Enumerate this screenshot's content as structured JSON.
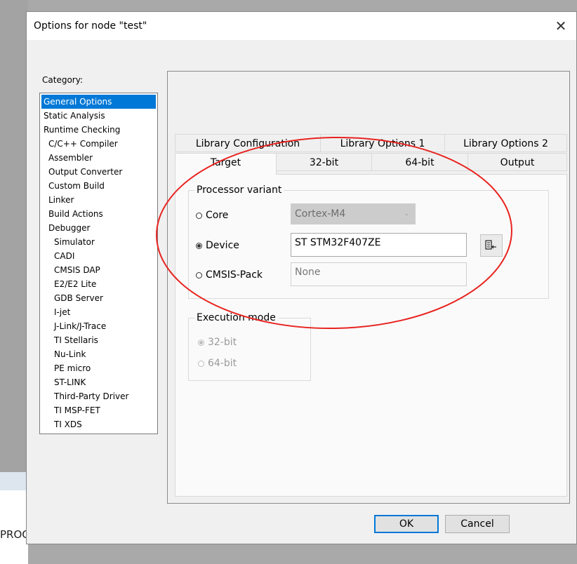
{
  "background": {
    "truncated_text": "PROC"
  },
  "dialog": {
    "title": "Options for node \"test\"",
    "close_glyph": "✕"
  },
  "category": {
    "label": "Category:",
    "items": [
      {
        "label": "General Options",
        "selected": true
      },
      {
        "label": "Static Analysis"
      },
      {
        "label": "Runtime Checking"
      },
      {
        "label": "C/C++ Compiler"
      },
      {
        "label": "Assembler"
      },
      {
        "label": "Output Converter"
      },
      {
        "label": "Custom Build"
      },
      {
        "label": "Linker"
      },
      {
        "label": "Build Actions"
      },
      {
        "label": "Debugger"
      },
      {
        "label": "Simulator"
      },
      {
        "label": "CADI"
      },
      {
        "label": "CMSIS DAP"
      },
      {
        "label": "E2/E2 Lite"
      },
      {
        "label": "GDB Server"
      },
      {
        "label": "I-jet"
      },
      {
        "label": "J-Link/J-Trace"
      },
      {
        "label": "TI Stellaris"
      },
      {
        "label": "Nu-Link"
      },
      {
        "label": "PE micro"
      },
      {
        "label": "ST-LINK"
      },
      {
        "label": "Third-Party Driver"
      },
      {
        "label": "TI MSP-FET"
      },
      {
        "label": "TI XDS"
      }
    ]
  },
  "tabs": {
    "row1": [
      "Library Configuration",
      "Library Options 1",
      "Library Options 2"
    ],
    "row2": [
      "Target",
      "32-bit",
      "64-bit",
      "Output"
    ],
    "active": "Target"
  },
  "processor_variant": {
    "legend": "Processor variant",
    "core_label": "Core",
    "core_value": "Cortex-M4",
    "device_label": "Device",
    "device_value": "ST STM32F407ZE",
    "cmsis_label": "CMSIS-Pack",
    "cmsis_value": "None",
    "selected": "Device"
  },
  "execution_mode": {
    "legend": "Execution mode",
    "options": [
      "32-bit",
      "64-bit"
    ],
    "selected": "32-bit"
  },
  "buttons": {
    "ok": "OK",
    "cancel": "Cancel"
  },
  "colors": {
    "selection": "#0078d7",
    "annotation": "#e8231f"
  },
  "icons": {
    "close": "close-icon",
    "device_browse": "device-select-icon",
    "combo_arrow": "chevron-down-icon"
  }
}
